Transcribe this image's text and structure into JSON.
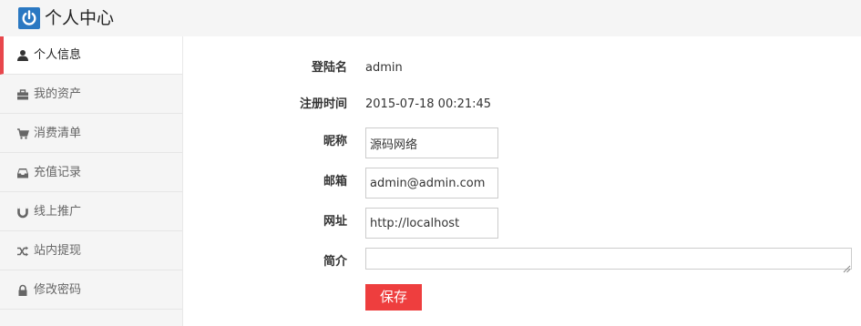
{
  "header": {
    "title": "个人中心",
    "logo_icon": "power-icon",
    "logo_color": "#2a78c2"
  },
  "sidebar": {
    "active_color": "#e8474c",
    "items": [
      {
        "label": "个人信息",
        "icon": "user-icon",
        "active": true
      },
      {
        "label": "我的资产",
        "icon": "briefcase-icon",
        "active": false
      },
      {
        "label": "消费清单",
        "icon": "cart-icon",
        "active": false
      },
      {
        "label": "充值记录",
        "icon": "inbox-icon",
        "active": false
      },
      {
        "label": "线上推广",
        "icon": "magnet-icon",
        "active": false
      },
      {
        "label": "站内提现",
        "icon": "shuffle-icon",
        "active": false
      },
      {
        "label": "修改密码",
        "icon": "lock-icon",
        "active": false
      }
    ]
  },
  "form": {
    "username": {
      "label": "登陆名",
      "value": "admin"
    },
    "register_time": {
      "label": "注册时间",
      "value": "2015-07-18 00:21:45"
    },
    "nickname": {
      "label": "昵称",
      "value": "源码网络"
    },
    "email": {
      "label": "邮箱",
      "value": "admin@admin.com"
    },
    "website": {
      "label": "网址",
      "value": "http://localhost"
    },
    "bio": {
      "label": "简介",
      "value": ""
    },
    "save_label": "保存",
    "save_color": "#ee3e3e"
  }
}
